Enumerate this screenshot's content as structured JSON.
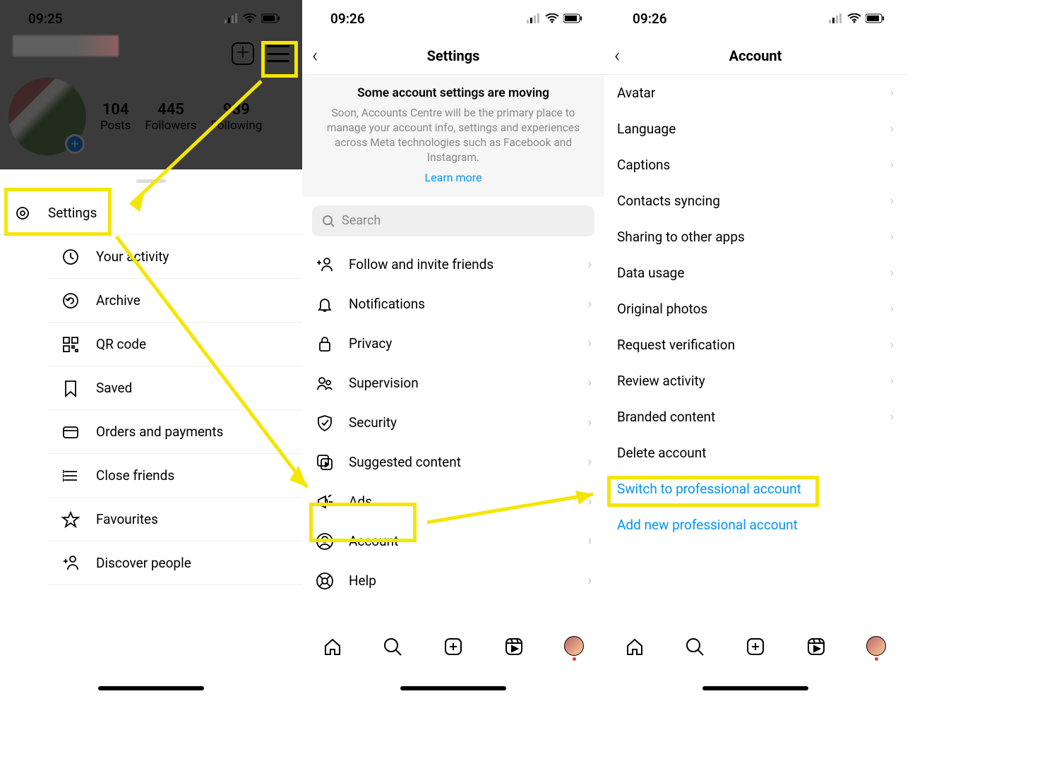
{
  "colors": {
    "highlight": "#f4e600",
    "link": "#0095f6"
  },
  "phone1": {
    "time": "09:25",
    "stats": {
      "posts_n": "104",
      "posts_l": "Posts",
      "followers_n": "445",
      "followers_l": "Followers",
      "following_n": "939",
      "following_l": "Following"
    },
    "menu": [
      {
        "id": "settings",
        "label": "Settings"
      },
      {
        "id": "your-activity",
        "label": "Your activity"
      },
      {
        "id": "archive",
        "label": "Archive"
      },
      {
        "id": "qr-code",
        "label": "QR code"
      },
      {
        "id": "saved",
        "label": "Saved"
      },
      {
        "id": "orders",
        "label": "Orders and payments"
      },
      {
        "id": "close-friends",
        "label": "Close friends"
      },
      {
        "id": "favourites",
        "label": "Favourites"
      },
      {
        "id": "discover",
        "label": "Discover people"
      }
    ]
  },
  "phone2": {
    "time": "09:26",
    "title": "Settings",
    "notice_title": "Some account settings are moving",
    "notice_body": "Soon, Accounts Centre will be the primary place to manage your account info, settings and experiences across Meta technologies such as Facebook and Instagram.",
    "notice_link": "Learn more",
    "search_placeholder": "Search",
    "items": [
      {
        "id": "follow-invite",
        "label": "Follow and invite friends"
      },
      {
        "id": "notifications",
        "label": "Notifications"
      },
      {
        "id": "privacy",
        "label": "Privacy"
      },
      {
        "id": "supervision",
        "label": "Supervision"
      },
      {
        "id": "security",
        "label": "Security"
      },
      {
        "id": "suggested",
        "label": "Suggested content"
      },
      {
        "id": "ads",
        "label": "Ads"
      },
      {
        "id": "account",
        "label": "Account"
      },
      {
        "id": "help",
        "label": "Help"
      }
    ]
  },
  "phone3": {
    "time": "09:26",
    "title": "Account",
    "items": [
      {
        "id": "avatar",
        "label": "Avatar"
      },
      {
        "id": "language",
        "label": "Language"
      },
      {
        "id": "captions",
        "label": "Captions"
      },
      {
        "id": "contacts-syncing",
        "label": "Contacts syncing"
      },
      {
        "id": "sharing-apps",
        "label": "Sharing to other apps"
      },
      {
        "id": "data-usage",
        "label": "Data usage"
      },
      {
        "id": "original-photos",
        "label": "Original photos"
      },
      {
        "id": "request-verification",
        "label": "Request verification"
      },
      {
        "id": "review-activity",
        "label": "Review activity"
      },
      {
        "id": "branded-content",
        "label": "Branded content"
      },
      {
        "id": "delete-account",
        "label": "Delete account",
        "nochev": true
      }
    ],
    "links": [
      {
        "id": "switch-pro",
        "label": "Switch to professional account"
      },
      {
        "id": "add-pro",
        "label": "Add new professional account"
      }
    ]
  }
}
